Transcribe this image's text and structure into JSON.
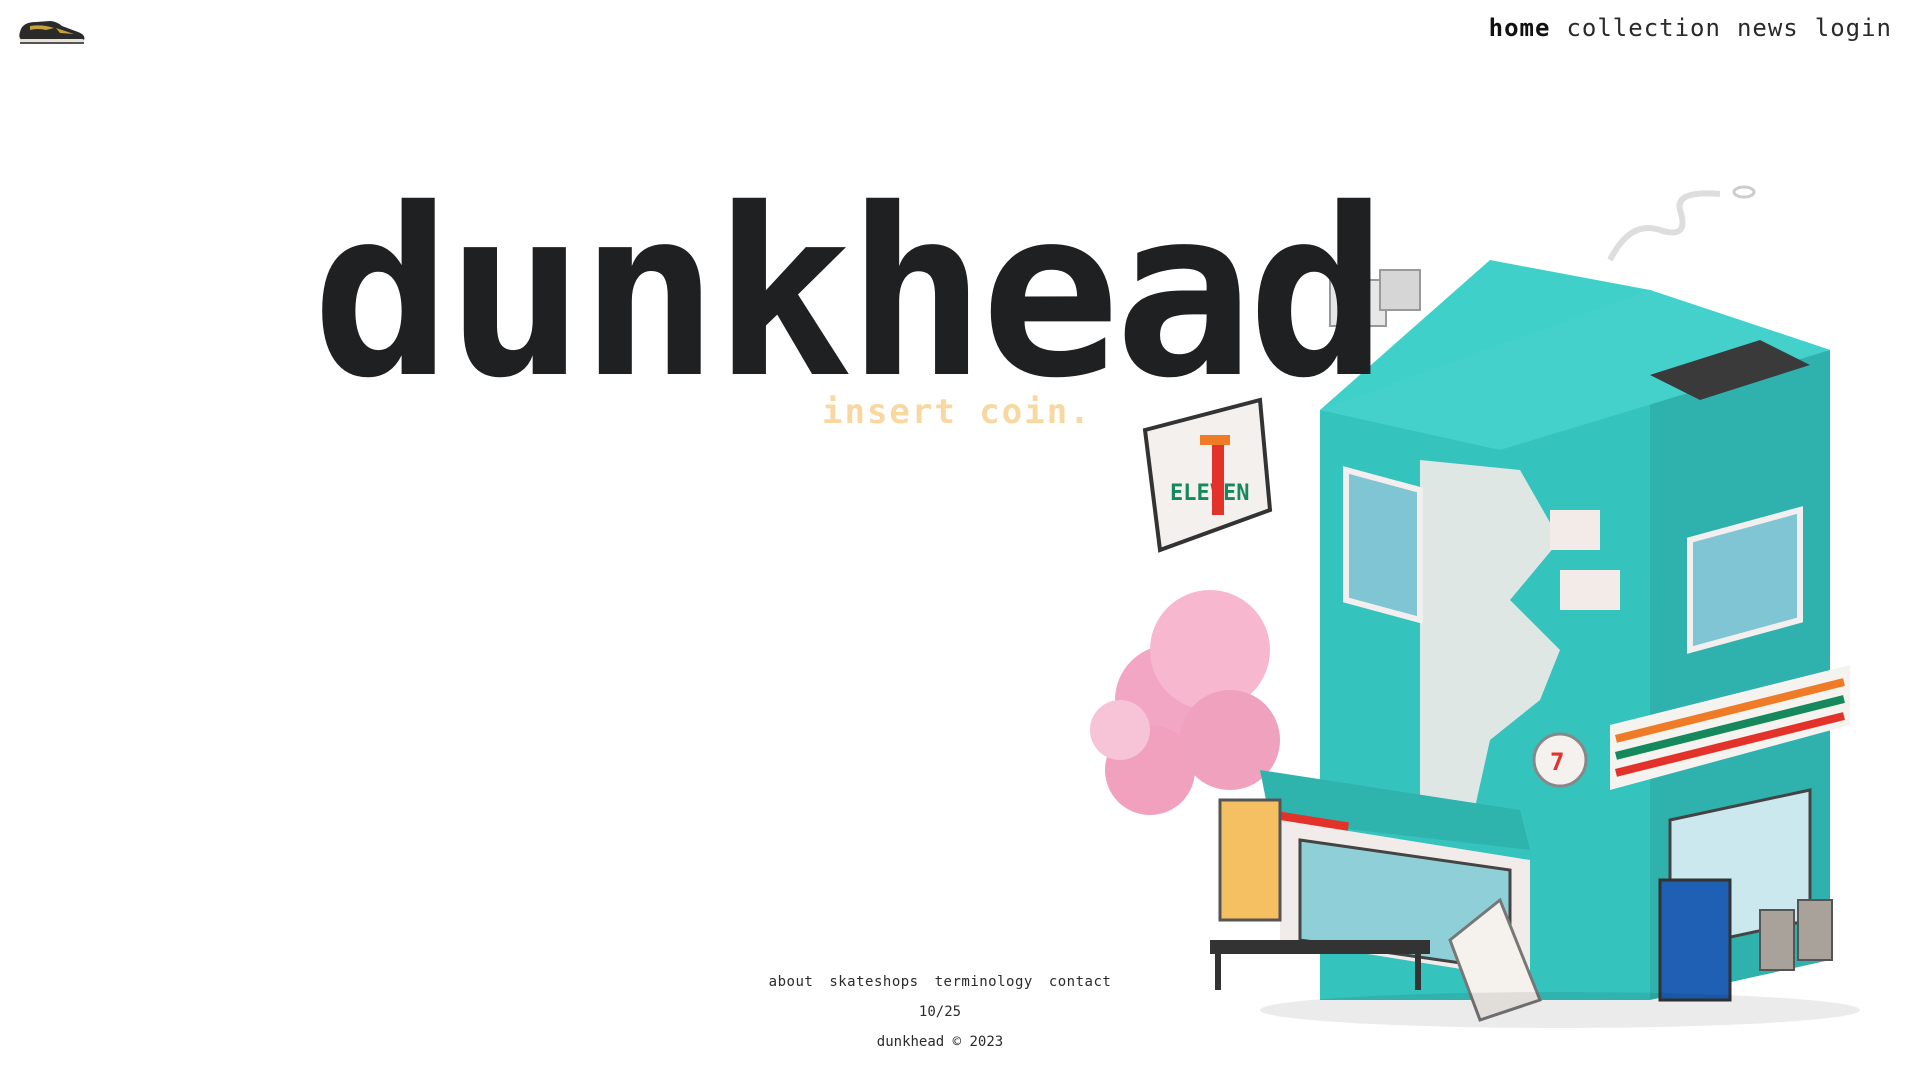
{
  "header": {
    "logo_icon": "sneaker-icon",
    "nav": [
      {
        "label": "home",
        "active": true
      },
      {
        "label": "collection",
        "active": false
      },
      {
        "label": "news",
        "active": false
      },
      {
        "label": "login",
        "active": false
      }
    ]
  },
  "hero": {
    "title": "dunkhead",
    "tagline": "insert coin."
  },
  "illustration": {
    "icon": "convenience-store-illustration",
    "sign_text": "ELEVEN"
  },
  "footer": {
    "links": [
      "about",
      "skateshops",
      "terminology",
      "contact"
    ],
    "count": "10/25",
    "copyright": "dunkhead © 2023"
  },
  "colors": {
    "title": "#1e2022",
    "tagline": "#f9d7a0",
    "teal": "#35c3bd",
    "blossom": "#f3a6c3"
  }
}
